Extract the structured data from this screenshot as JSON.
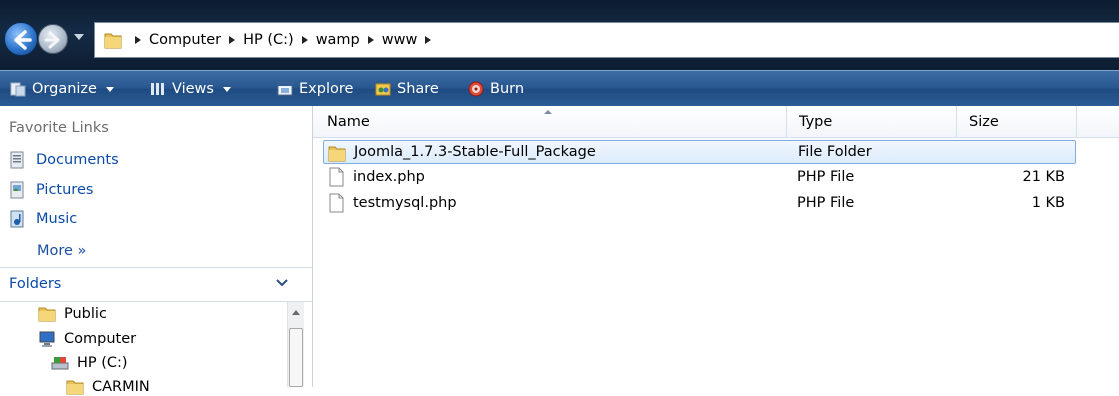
{
  "address_bar": {
    "breadcrumbs": [
      "Computer",
      "HP (C:)",
      "wamp",
      "www"
    ]
  },
  "command_bar": {
    "organize": "Organize",
    "views": "Views",
    "explore": "Explore",
    "share": "Share",
    "burn": "Burn"
  },
  "nav_pane": {
    "favorite_links_title": "Favorite Links",
    "links": [
      "Documents",
      "Pictures",
      "Music"
    ],
    "more_label": "More »",
    "folders_title": "Folders",
    "tree": [
      "Public",
      "Computer",
      "HP (C:)",
      "CARMIN"
    ]
  },
  "file_list": {
    "columns": {
      "name": "Name",
      "type": "Type",
      "size": "Size"
    },
    "rows": [
      {
        "name": "Joomla_1.7.3-Stable-Full_Package",
        "type": "File Folder",
        "size": "",
        "icon": "folder-icon"
      },
      {
        "name": "index.php",
        "type": "PHP File",
        "size": "21 KB",
        "icon": "file-icon"
      },
      {
        "name": "testmysql.php",
        "type": "PHP File",
        "size": "1 KB",
        "icon": "file-icon"
      }
    ]
  },
  "colors": {
    "link_blue": "#0b4ba8",
    "selection_border": "#84acdd",
    "toolbar_blue": "#27568e"
  }
}
